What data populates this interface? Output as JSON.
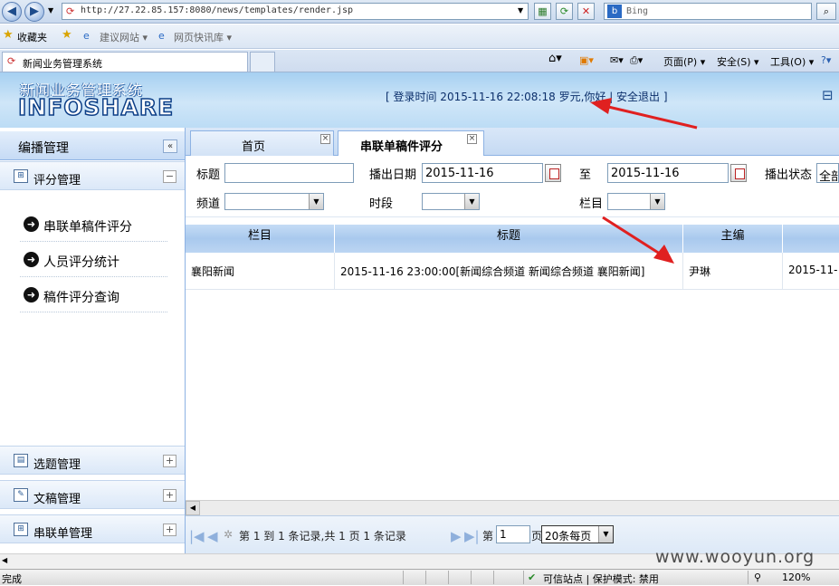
{
  "browser": {
    "url": "http://27.22.85.157:8080/news/templates/render.jsp",
    "search_placeholder": "Bing",
    "favorites_label": "收藏夹",
    "fav_links": [
      "建议网站 ▾",
      "网页快讯库 ▾"
    ],
    "tab_title": "新闻业务管理系统",
    "commands": [
      "页面(P) ▾",
      "安全(S) ▾",
      "工具(O) ▾"
    ],
    "status_left": "完成",
    "status_zone": "可信站点 | 保护模式: 禁用",
    "zoom": "120%"
  },
  "header": {
    "system_title": "新闻业务管理系统",
    "logo": "INFOSHARE",
    "login_info": "[ 登录时间 2015-11-16 22:08:18    罗元,你好    |    安全退出  ]"
  },
  "sidebar": {
    "title": "编播管理",
    "top_section": "评分管理",
    "items": [
      "串联单稿件评分",
      "人员评分统计",
      "稿件评分查询"
    ],
    "bottom_sections": [
      "选题管理",
      "文稿管理",
      "串联单管理"
    ]
  },
  "tabs": [
    {
      "label": "首页"
    },
    {
      "label": "串联单稿件评分"
    }
  ],
  "filters": {
    "title_label": "标题",
    "title_value": "",
    "date_label": "播出日期",
    "date_from": "2015-11-16",
    "to_label": "至",
    "date_to": "2015-11-16",
    "status_label": "播出状态",
    "status_value": "全部",
    "channel_label": "频道",
    "period_label": "时段",
    "column_label": "栏目"
  },
  "grid": {
    "columns": [
      "栏目",
      "标题",
      "主编",
      ""
    ],
    "rows": [
      [
        "襄阳新闻",
        "2015-11-16 23:00:00[新闻综合频道  新闻综合频道  襄阳新闻]",
        "尹琳",
        "2015-11-"
      ]
    ]
  },
  "pager": {
    "range_text": "第 1 到 1 条记录,共 1 页  1 条记录",
    "page_prefix": "第",
    "page_value": "1",
    "page_suffix": "页",
    "page_size": "20条每页"
  },
  "watermark": "www.wooyun.org",
  "colors": {
    "header_bg": "#bcdcf5",
    "annotation_arrow": "#e02020",
    "grid_header": "#a9c9ee"
  }
}
